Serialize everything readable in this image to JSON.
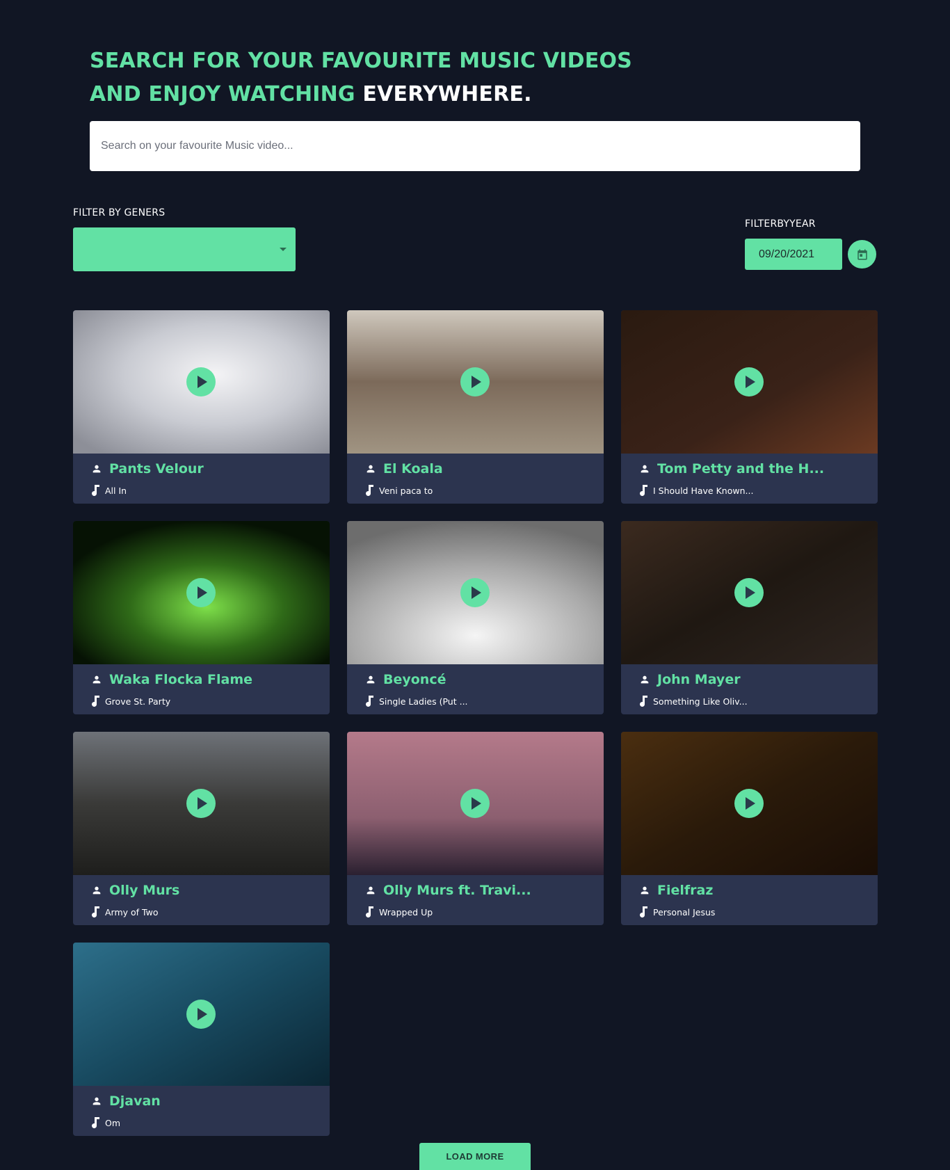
{
  "hero": {
    "line1": "SEARCH FOR YOUR FAVOURITE MUSIC VIDEOS",
    "line2_green": "AND ENJOY WATCHING ",
    "line2_white": "EVERYWHERE."
  },
  "search": {
    "placeholder": "Search on your favourite Music video...",
    "value": ""
  },
  "filters": {
    "genre_label": "FILTER BY GENERS",
    "genre_value": "",
    "year_label": "FILTERBYYEAR",
    "year_value": "09/20/2021"
  },
  "icons": {
    "dropdown": "chevron-down-icon",
    "calendar": "calendar-icon",
    "artist": "person-icon",
    "song": "music-note-icon",
    "play": "play-icon"
  },
  "colors": {
    "background": "#111624",
    "accent": "#62e1a4",
    "card": "#2c344f"
  },
  "videos": [
    {
      "artist": "Pants Velour",
      "song": "All In"
    },
    {
      "artist": "El Koala",
      "song": "Veni paca to"
    },
    {
      "artist": "Tom Petty and the H...",
      "song": "I Should Have Known..."
    },
    {
      "artist": "Waka Flocka Flame",
      "song": "Grove St. Party"
    },
    {
      "artist": "Beyoncé",
      "song": "Single Ladies (Put ..."
    },
    {
      "artist": "John Mayer",
      "song": "Something Like Oliv..."
    },
    {
      "artist": "Olly Murs",
      "song": "Army of Two"
    },
    {
      "artist": "Olly Murs ft. Travi...",
      "song": "Wrapped Up"
    },
    {
      "artist": "Fielfraz",
      "song": "Personal Jesus"
    },
    {
      "artist": "Djavan",
      "song": "Om"
    }
  ],
  "load_more": "LOAD MORE"
}
